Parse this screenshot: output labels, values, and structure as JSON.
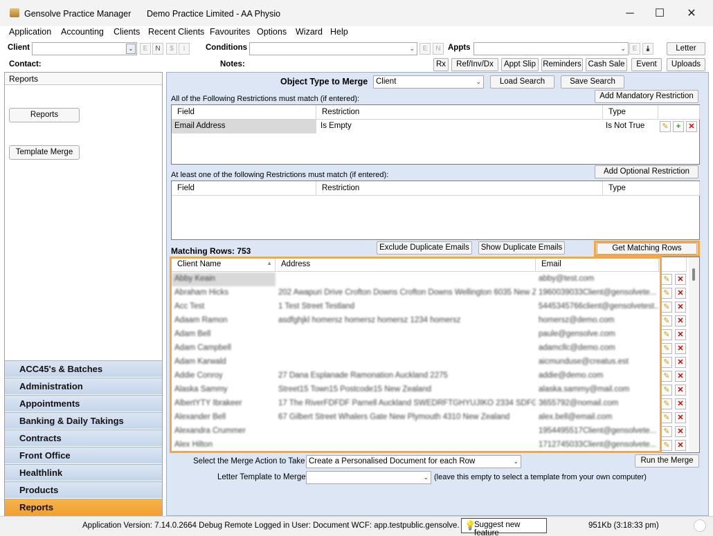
{
  "window": {
    "app_title": "Gensolve Practice Manager",
    "practice": "Demo Practice Limited - AA Physio",
    "minimize": "─",
    "maximize": "☐",
    "close": "✕"
  },
  "menu": [
    "Application",
    "Accounting",
    "Clients",
    "Recent Clients",
    "Favourites",
    "Options",
    "Wizard",
    "Help"
  ],
  "clientbar": {
    "client_label": "Client",
    "conditions_label": "Conditions",
    "appts_label": "Appts",
    "contact_label": "Contact:",
    "notes_label": "Notes:",
    "client_mini": [
      "E",
      "N",
      "$",
      "i"
    ],
    "cond_mini": [
      "E",
      "N"
    ],
    "appts_mini": [
      "E"
    ],
    "letter": "Letter",
    "actions": [
      "Rx",
      "Ref/Inv/Dx",
      "Appt Slip",
      "Reminders",
      "Cash Sale",
      "Event",
      "Uploads"
    ]
  },
  "left": {
    "header": "Reports",
    "reports_btn": "Reports",
    "template_btn": "Template Merge",
    "nav": [
      "ACC45's & Batches",
      "Administration",
      "Appointments",
      "Banking & Daily Takings",
      "Contracts",
      "Front Office",
      "Healthlink",
      "Products",
      "Reports"
    ]
  },
  "merge": {
    "object_type_label": "Object Type to Merge",
    "object_type_value": "Client",
    "load_search": "Load Search",
    "save_search": "Save Search",
    "all_restrictions_label": "All of the Following Restrictions must match (if entered):",
    "add_mandatory": "Add Mandatory Restriction",
    "col_field": "Field",
    "col_restriction": "Restriction",
    "col_type": "Type",
    "mandatory_rows": [
      {
        "field": "Email Address",
        "restriction": "Is Empty",
        "type": "Is Not True"
      }
    ],
    "optional_label": "At least one of the following Restrictions must match (if entered):",
    "add_optional": "Add Optional Restriction",
    "matching_rows": "Matching Rows: 753",
    "exclude_dup": "Exclude Duplicate Emails",
    "show_dup": "Show Duplicate Emails",
    "get_rows": "Get Matching Rows",
    "col_client_name": "Client Name",
    "col_address": "Address",
    "col_email": "Email",
    "rows": [
      {
        "name": "Abby Keain",
        "address": "",
        "email": "abby@test.com"
      },
      {
        "name": "Abraham Hicks",
        "address": "202 Awapuri Drive Crofton Downs Crofton Downs Wellington 6035 New Ze...",
        "email": "1960039033Client@gensolvete..."
      },
      {
        "name": "Acc Test",
        "address": "1 Test Street Testland",
        "email": "5445345766client@gensolvetest..."
      },
      {
        "name": "Adaam Ramon",
        "address": "asdfghjkl homersz homersz homersz 1234 homersz",
        "email": "homersz@demo.com"
      },
      {
        "name": "Adam Bell",
        "address": "",
        "email": "paule@gensolve.com"
      },
      {
        "name": "Adam Campbell",
        "address": "",
        "email": "adamcllc@demo.com"
      },
      {
        "name": "Adam Karwald",
        "address": "",
        "email": "aicmunduse@creatus.est"
      },
      {
        "name": "Addie Conroy",
        "address": "27 Dana Esplanade Ramonation Auckland 2275",
        "email": "addie@demo.com"
      },
      {
        "name": "Alaska Sammy",
        "address": "Street15 Town15 Postcode15 New Zealand",
        "email": "alaska.sammy@mail.com"
      },
      {
        "name": "AlbertYTY Ibrakeer",
        "address": "17 The RiverFDFDF Parnell Auckland SWEDRFTGHYUJIKO 2334 SDFGH...",
        "email": "3655792@nomail.com"
      },
      {
        "name": "Alexander Bell",
        "address": "67 Gilbert Street Whalers Gate New Plymouth 4310 New Zealand",
        "email": "alex.bell@email.com"
      },
      {
        "name": "Alexandra Crummer",
        "address": "",
        "email": "1954495517Client@gensolvete..."
      },
      {
        "name": "Alex Hilton",
        "address": "",
        "email": "1712745033Client@gensolvete..."
      }
    ],
    "merge_action_label": "Select the Merge Action to Take",
    "merge_action_value": "Create a Personalised Document for each Row",
    "run_merge": "Run the Merge",
    "template_label": "Letter Template to Merge",
    "template_value": "",
    "template_hint": "(leave this empty to select a template from your own computer)"
  },
  "status": {
    "version": "Application Version: 7.14.0.2664 Debug Remote  Logged in User: Document WCF: app.testpublic.gensolve.com:45",
    "suggest": "Suggest new feature",
    "memory": "951Kb  (3:18:33 pm)"
  },
  "colors": {
    "accent_orange": "#f7a742",
    "nav_blue": "#c5d5ea",
    "panel_bg": "#dce6f4",
    "delete_red": "#d40000",
    "edit_yellow": "#e6c000"
  }
}
